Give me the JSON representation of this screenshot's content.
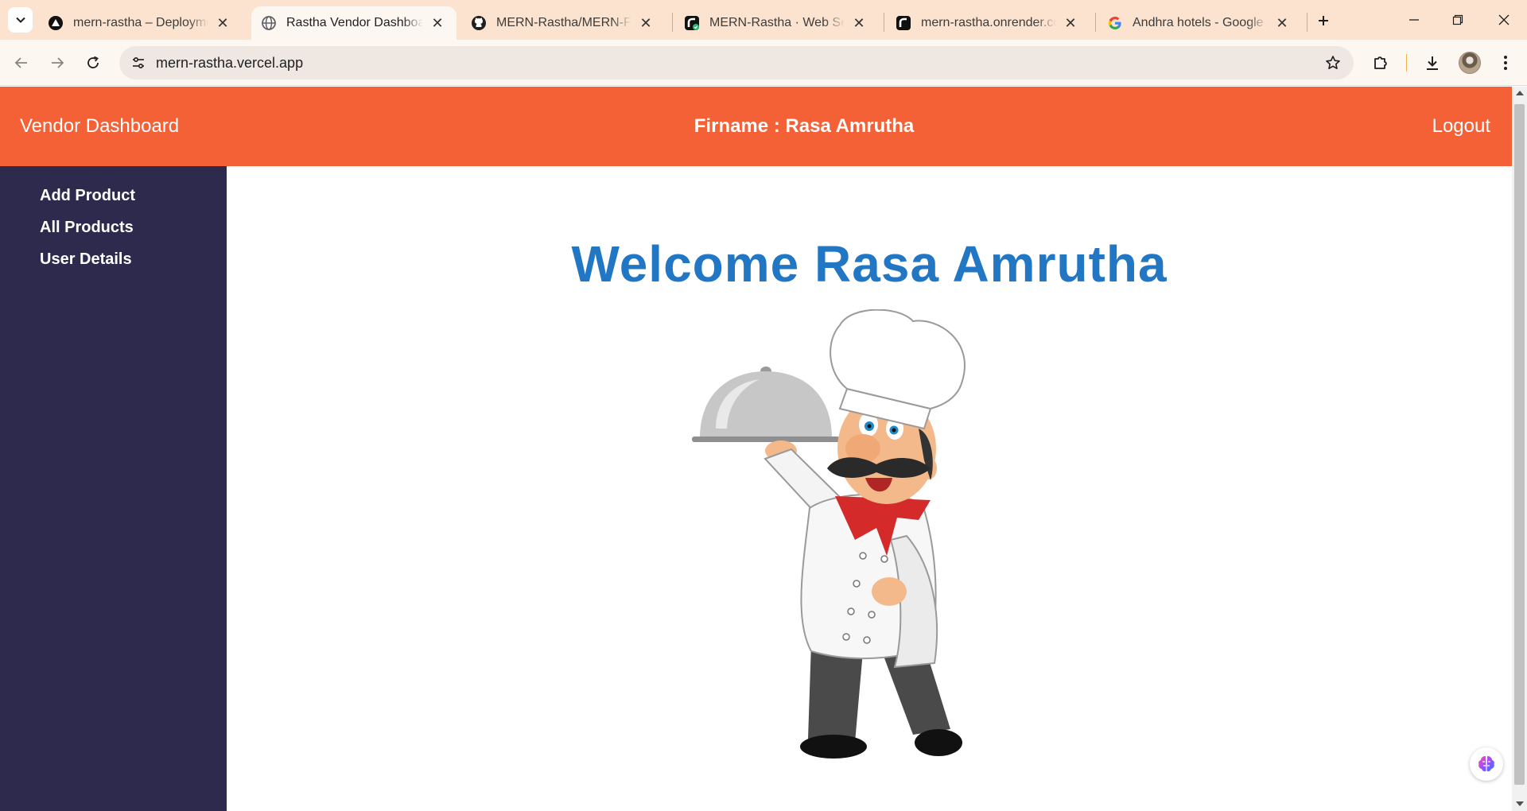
{
  "browser": {
    "tabs": [
      {
        "title": "mern-rastha – Deployment",
        "favicon": "vercel-icon",
        "active": false
      },
      {
        "title": "Rastha Vendor Dashboard",
        "favicon": "globe-icon",
        "active": true
      },
      {
        "title": "MERN-Rastha/MERN-Front",
        "favicon": "github-icon",
        "active": false
      },
      {
        "title": "MERN-Rastha · Web Servic",
        "favicon": "render-icon",
        "active": false
      },
      {
        "title": "mern-rastha.onrender.com",
        "favicon": "render-icon",
        "active": false
      },
      {
        "title": "Andhra hotels - Google Se",
        "favicon": "google-icon",
        "active": false
      }
    ],
    "url": "mern-rastha.vercel.app",
    "accent_color": "#fbe3cf"
  },
  "header": {
    "brand": "Vendor Dashboard",
    "firm_label": "Firname : Rasa Amrutha",
    "logout_label": "Logout",
    "bg_color": "#f46136"
  },
  "sidebar": {
    "items": [
      {
        "label": "Add Product"
      },
      {
        "label": "All Products"
      },
      {
        "label": "User Details"
      }
    ],
    "bg_color": "#2e2a4d"
  },
  "main": {
    "welcome": "Welcome Rasa Amrutha",
    "welcome_color": "#2277c5",
    "image": "chef-holding-cloche-illustration"
  }
}
